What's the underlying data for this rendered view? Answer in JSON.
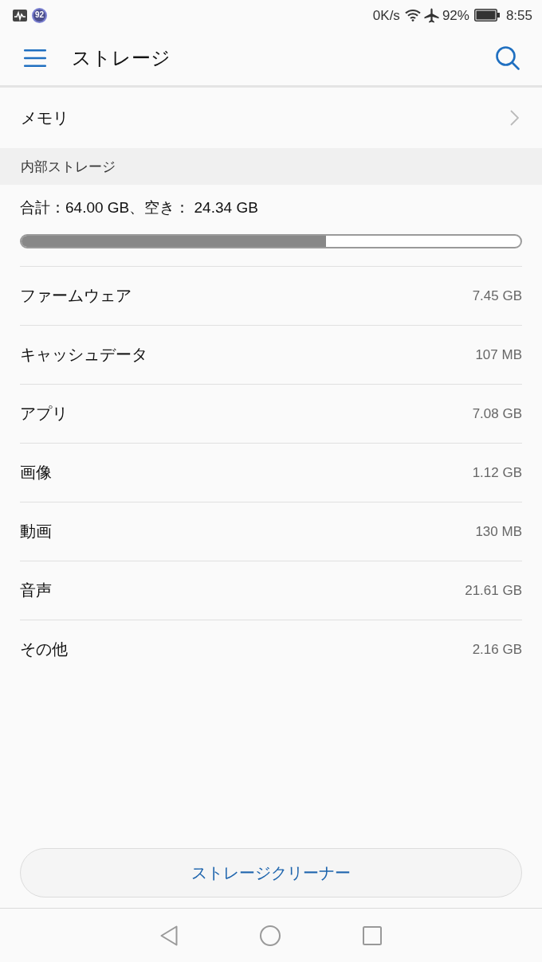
{
  "status_bar": {
    "badge": "92",
    "network_speed": "0K/s",
    "battery_percent": "92%",
    "time": "8:55"
  },
  "app_bar": {
    "title": "ストレージ"
  },
  "memory_row": {
    "label": "メモリ"
  },
  "internal_storage": {
    "header": "内部ストレージ",
    "summary": "合計：64.00 GB、空き： 24.34 GB",
    "level": 0.61
  },
  "categories": [
    {
      "label": "ファームウェア",
      "size": "7.45 GB"
    },
    {
      "label": "キャッシュデータ",
      "size": "107 MB"
    },
    {
      "label": "アプリ",
      "size": "7.08 GB"
    },
    {
      "label": "画像",
      "size": "1.12 GB"
    },
    {
      "label": "動画",
      "size": "130 MB"
    },
    {
      "label": "音声",
      "size": "21.61 GB"
    },
    {
      "label": "その他",
      "size": "2.16 GB"
    }
  ],
  "cleaner_button": {
    "label": "ストレージクリーナー"
  }
}
